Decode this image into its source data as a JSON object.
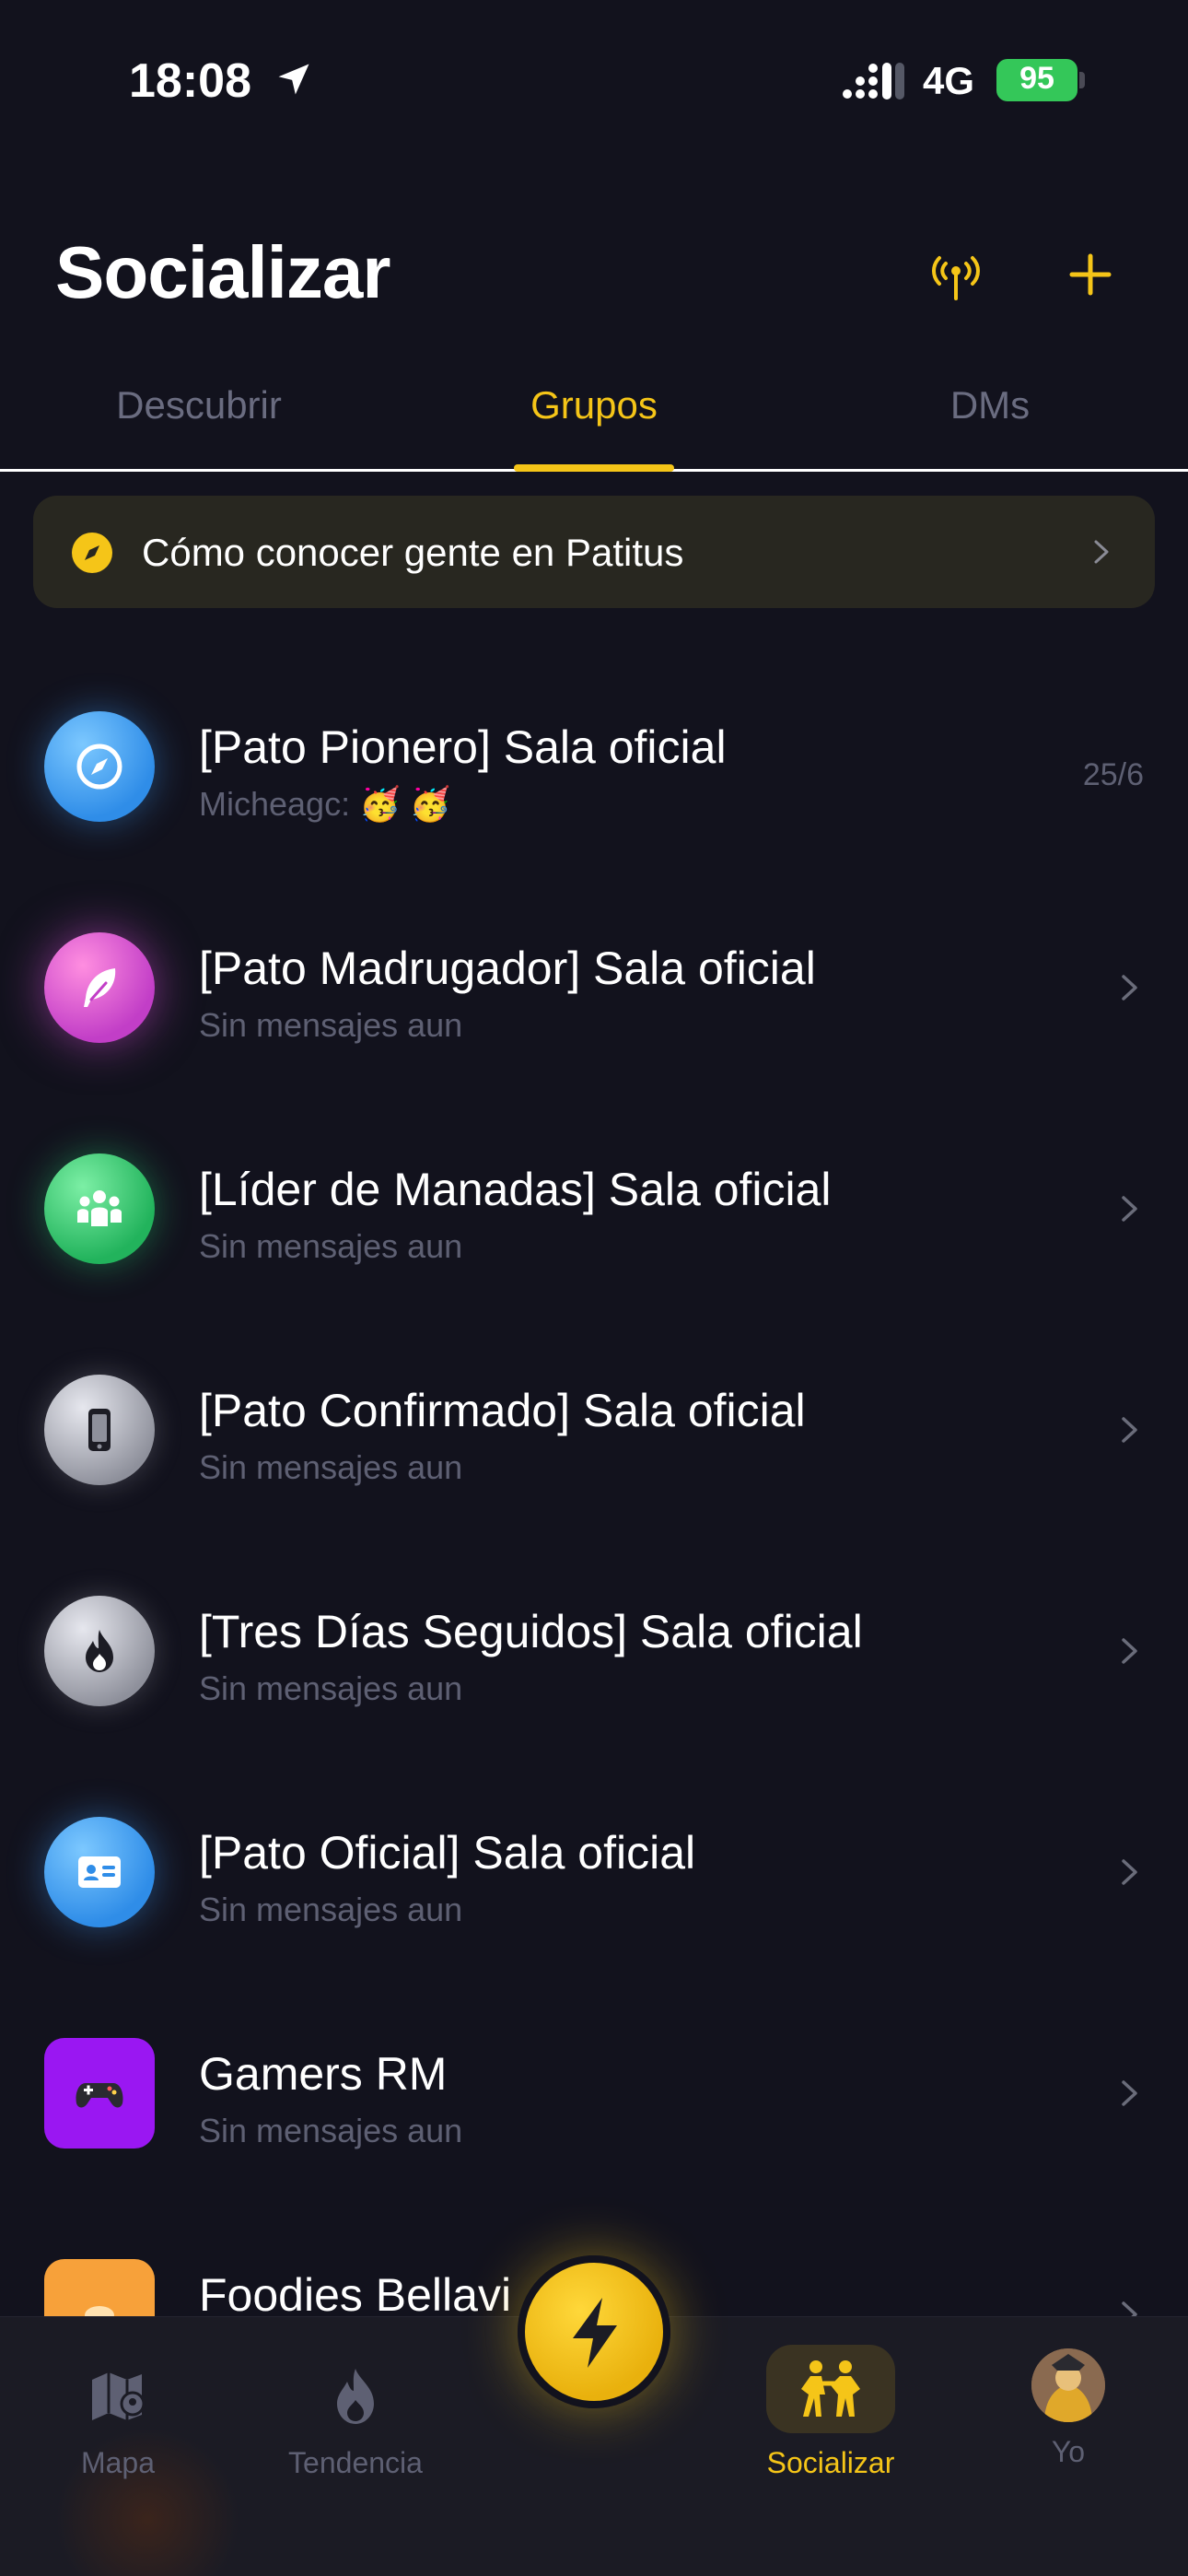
{
  "status_bar": {
    "time": "18:08",
    "network": "4G",
    "battery": "95"
  },
  "header": {
    "title": "Socializar"
  },
  "tabs": [
    {
      "label": "Descubrir",
      "active": false
    },
    {
      "label": "Grupos",
      "active": true
    },
    {
      "label": "DMs",
      "active": false
    }
  ],
  "guide_banner": {
    "text": "Cómo conocer gente en Patitus"
  },
  "groups": [
    {
      "title": "[Pato Pionero] Sala oficial",
      "subtitle": "Micheagc: 🥳 🥳",
      "date": "25/6",
      "icon": "compass-icon"
    },
    {
      "title": "[Pato Madrugador] Sala oficial",
      "subtitle": "Sin mensajes aun",
      "icon": "feather-icon"
    },
    {
      "title": "[Líder de Manadas] Sala oficial",
      "subtitle": "Sin mensajes aun",
      "icon": "people-icon"
    },
    {
      "title": "[Pato Confirmado] Sala oficial",
      "subtitle": "Sin mensajes aun",
      "icon": "phone-icon"
    },
    {
      "title": "[Tres Días Seguidos] Sala oficial",
      "subtitle": "Sin mensajes aun",
      "icon": "flame-icon"
    },
    {
      "title": "[Pato Oficial] Sala oficial",
      "subtitle": "Sin mensajes aun",
      "icon": "id-card-icon"
    },
    {
      "title": "Gamers RM",
      "subtitle": "Sin mensajes aun",
      "icon": "gamepad-icon"
    },
    {
      "title": "Foodies Bellavi",
      "subtitle": "",
      "icon": "food-icon"
    }
  ],
  "bottom_nav": [
    {
      "label": "Mapa",
      "icon": "map-icon"
    },
    {
      "label": "Tendencia",
      "icon": "flame-icon"
    },
    {
      "label": "Socializar",
      "icon": "people-walking-icon",
      "active": true
    },
    {
      "label": "Yo",
      "icon": "user-avatar"
    }
  ],
  "colors": {
    "background": "#12121d",
    "accent": "#f5c518",
    "muted": "#5e6073",
    "banner": "#282720"
  }
}
